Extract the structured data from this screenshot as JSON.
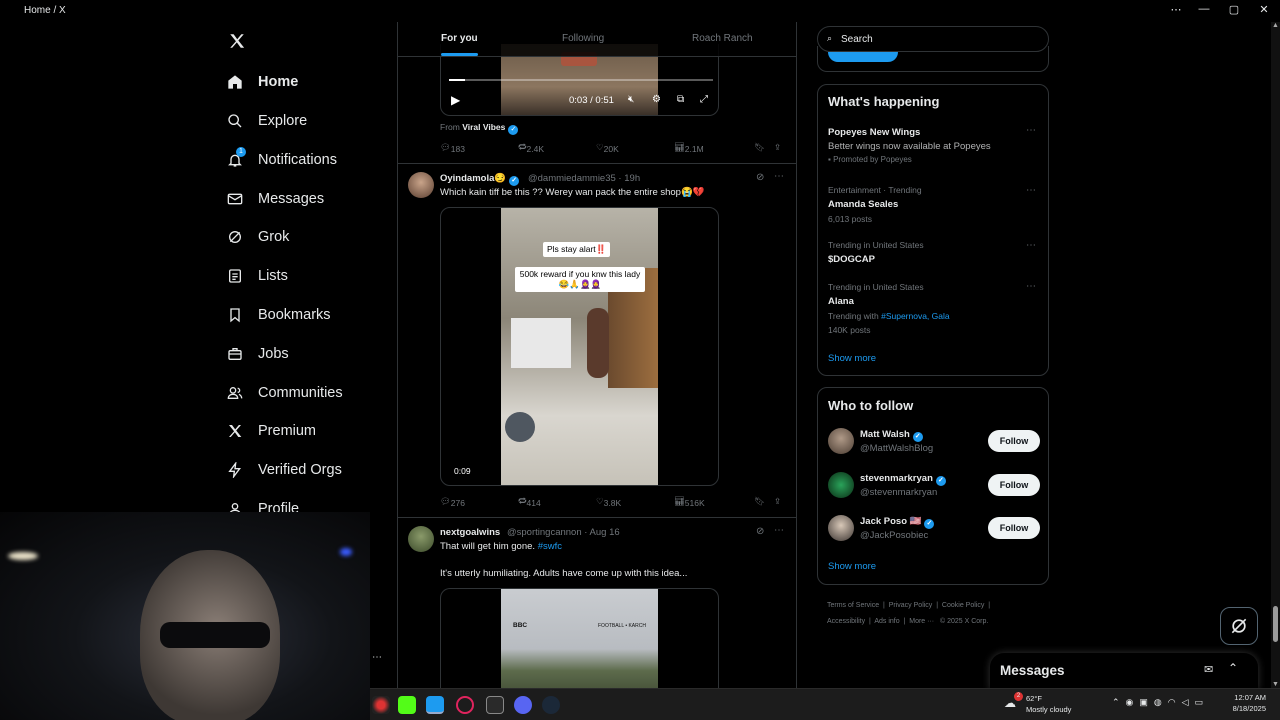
{
  "window": {
    "title": "Home / X"
  },
  "nav": {
    "items": [
      {
        "label": "Home",
        "icon": "home-icon"
      },
      {
        "label": "Explore",
        "icon": "search-icon"
      },
      {
        "label": "Notifications",
        "icon": "bell-icon"
      },
      {
        "label": "Messages",
        "icon": "envelope-icon"
      },
      {
        "label": "Grok",
        "icon": "grok-icon"
      },
      {
        "label": "Lists",
        "icon": "list-icon"
      },
      {
        "label": "Bookmarks",
        "icon": "bookmark-icon"
      },
      {
        "label": "Jobs",
        "icon": "briefcase-icon"
      },
      {
        "label": "Communities",
        "icon": "people-icon"
      },
      {
        "label": "Premium",
        "icon": "x-logo-icon"
      },
      {
        "label": "Verified Orgs",
        "icon": "lightning-icon"
      },
      {
        "label": "Profile",
        "icon": "person-icon"
      }
    ],
    "notifications_badge": "1"
  },
  "tabs": [
    "For you",
    "Following",
    "Roach Ranch"
  ],
  "video1": {
    "time": "0:03 / 0:51",
    "from_label": "From",
    "from_name": "Viral Vibes",
    "progress": 0.06,
    "stats": {
      "replies": "183",
      "reposts": "2.4K",
      "likes": "20K",
      "views": "2.1M"
    }
  },
  "tweet1": {
    "name": "Oyindamola😏",
    "handle": "@dammiedammie35",
    "time": "19h",
    "text": "Which kain tiff be this ?? Werey wan pack the entire shop😭💔",
    "caption1": "Pls stay alart‼️",
    "caption2": "500k reward if you knw this lady 😂🙏🧕🧕",
    "duration": "0:09",
    "stats": {
      "replies": "276",
      "reposts": "414",
      "likes": "3.8K",
      "views": "516K"
    }
  },
  "tweet2": {
    "name": "nextgoalwins",
    "handle": "@sportingcannon",
    "time": "Aug 16",
    "text": "That will get him gone.",
    "hashtag": "#swfc",
    "text2": "It's utterly humiliating. Adults have come up with this idea...",
    "overlay_left": "BBC",
    "overlay_right": "FOOTBALL • KARCH"
  },
  "search": {
    "placeholder": "Search"
  },
  "whats_happening": {
    "title": "What's happening",
    "trends": [
      {
        "title": "Popeyes New Wings",
        "sub": "Better wings now available at Popeyes",
        "meta": "Promoted by Popeyes"
      },
      {
        "context": "Entertainment · Trending",
        "title": "Amanda Seales",
        "meta": "6,013 posts"
      },
      {
        "context": "Trending in United States",
        "title": "$DOGCAP"
      },
      {
        "context": "Trending in United States",
        "title": "Alana",
        "with_label": "Trending with",
        "with": "#Supernova, Gala",
        "meta": "140K posts"
      }
    ],
    "show_more": "Show more"
  },
  "who_to_follow": {
    "title": "Who to follow",
    "users": [
      {
        "name": "Matt Walsh",
        "handle": "@MattWalshBlog",
        "flag": "",
        "button": "Follow"
      },
      {
        "name": "stevenmarkryan",
        "handle": "@stevenmarkryan",
        "flag": "",
        "button": "Follow"
      },
      {
        "name": "Jack Poso",
        "handle": "@JackPosobiec",
        "flag": "🇺🇸",
        "button": "Follow"
      }
    ],
    "show_more": "Show more"
  },
  "footer": {
    "links": [
      "Terms of Service",
      "Privacy Policy",
      "Cookie Policy",
      "Accessibility",
      "Ads info",
      "More ···"
    ],
    "copyright": "© 2025 X Corp."
  },
  "messages_drawer": {
    "label": "Messages"
  },
  "taskbar": {
    "weather_temp": "62°F",
    "weather_desc": "Mostly cloudy",
    "weather_badge": "2",
    "time": "12:07 AM",
    "date": "8/18/2025"
  },
  "colors": {
    "accent": "#1d9bf0",
    "bg": "#000000",
    "border": "#2f3336",
    "muted": "#71767b"
  }
}
